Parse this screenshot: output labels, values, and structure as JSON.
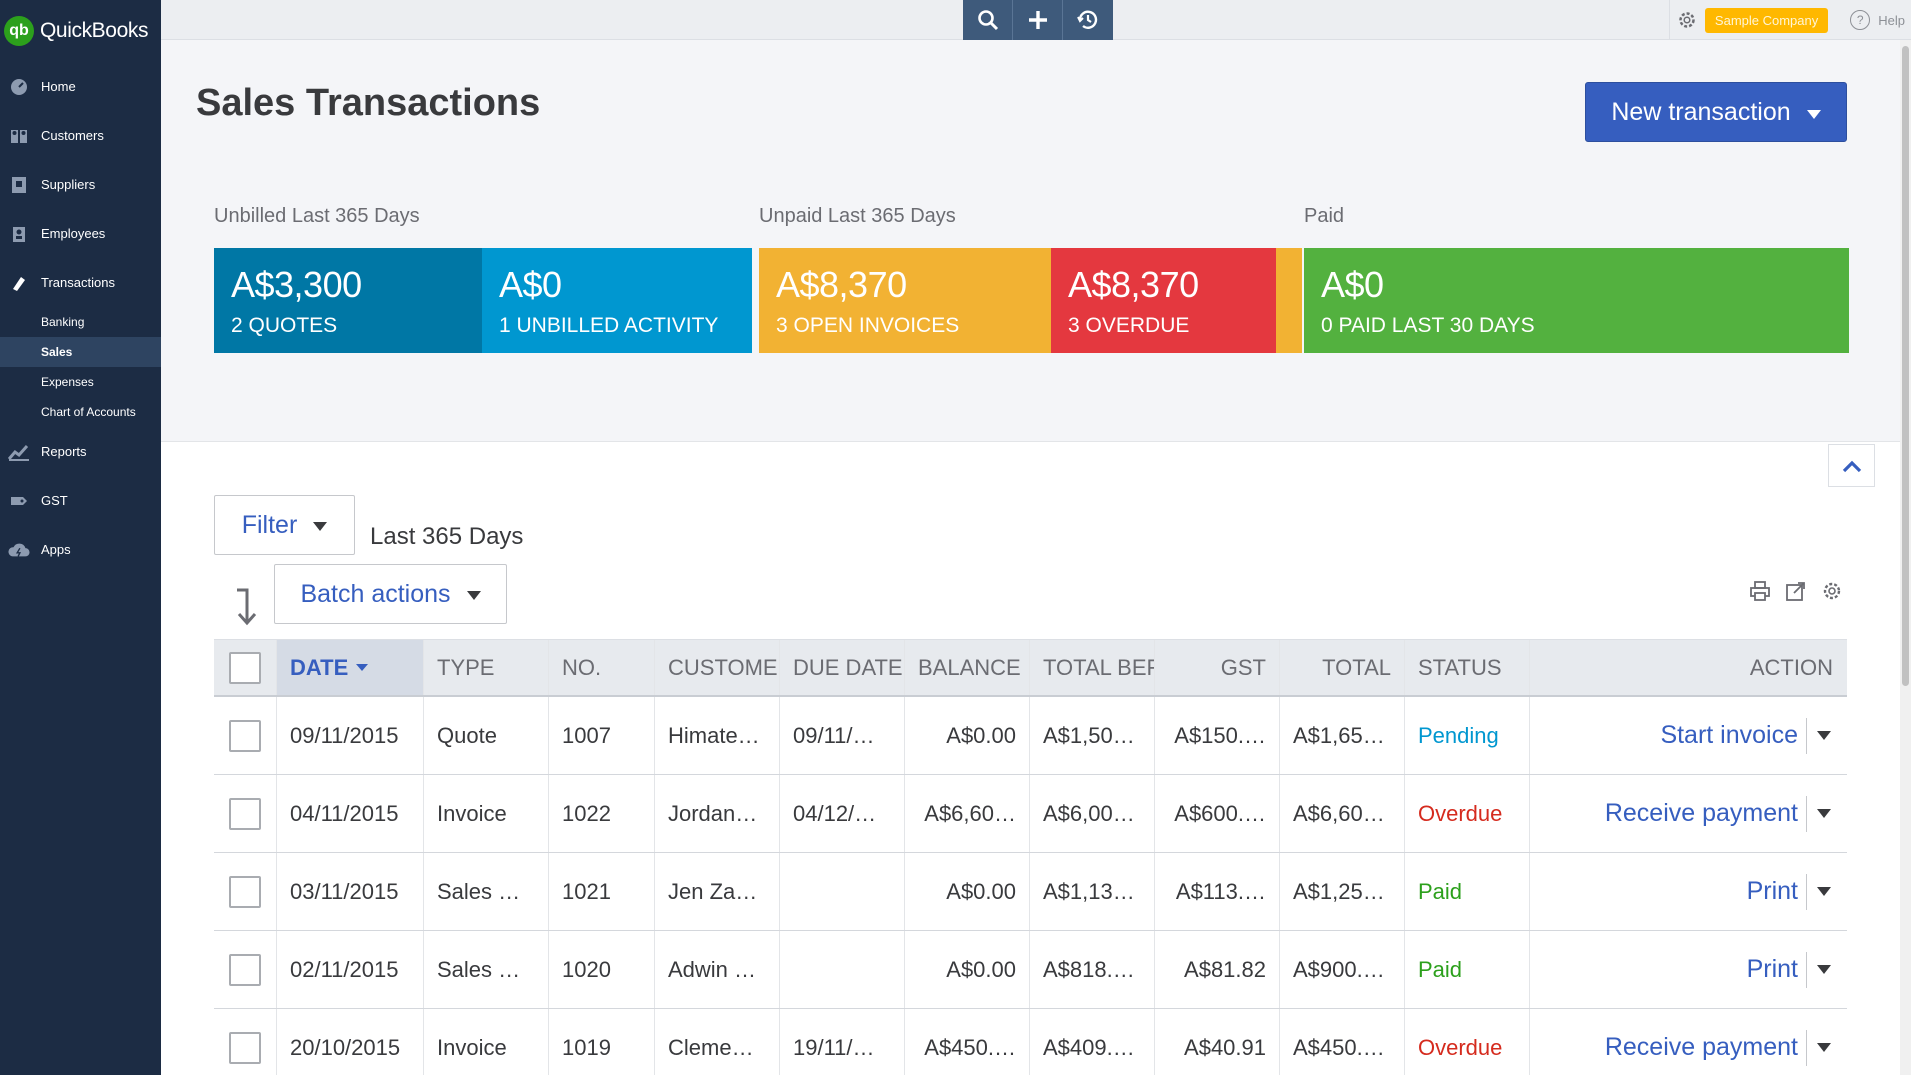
{
  "app": {
    "logo_text": "QuickBooks",
    "logo_badge": "qb"
  },
  "sidebar": {
    "items": [
      {
        "label": "Home",
        "icon": "home-dial-icon"
      },
      {
        "label": "Customers",
        "icon": "customers-icon"
      },
      {
        "label": "Suppliers",
        "icon": "suppliers-icon"
      },
      {
        "label": "Employees",
        "icon": "employees-icon"
      },
      {
        "label": "Transactions",
        "icon": "transactions-icon"
      }
    ],
    "sub_items": [
      {
        "label": "Banking"
      },
      {
        "label": "Sales",
        "active": true
      },
      {
        "label": "Expenses"
      },
      {
        "label": "Chart of Accounts"
      }
    ],
    "items_after": [
      {
        "label": "Reports",
        "icon": "reports-icon"
      },
      {
        "label": "GST",
        "icon": "gst-icon"
      },
      {
        "label": "Apps",
        "icon": "apps-cloud-icon"
      }
    ]
  },
  "topbar": {
    "company": "Sample Company",
    "help": "Help"
  },
  "page": {
    "title": "Sales Transactions",
    "new_transaction": "New transaction"
  },
  "money_bar": {
    "groups": {
      "unbilled": "Unbilled Last 365 Days",
      "unpaid": "Unpaid Last 365 Days",
      "paid": "Paid"
    },
    "segments": [
      {
        "amount": "A$3,300",
        "caption": "2 QUOTES",
        "color": "#0077a5"
      },
      {
        "amount": "A$0",
        "caption": "1 UNBILLED ACTIVITY",
        "color": "#0097d0"
      },
      {
        "amount": "A$8,370",
        "caption": "3 OPEN INVOICES",
        "color": "#f2b233"
      },
      {
        "amount": "A$8,370",
        "caption": "3 OVERDUE",
        "color": "#e4383f"
      },
      {
        "amount": "A$0",
        "caption": "0 PAID LAST 30 DAYS",
        "color": "#53b13f"
      }
    ]
  },
  "filter": {
    "label": "Filter",
    "range": "Last 365 Days",
    "batch_actions": "Batch actions"
  },
  "table": {
    "headers": {
      "date": "DATE",
      "type": "TYPE",
      "no": "NO.",
      "customer": "CUSTOMER",
      "due_date": "DUE DATE",
      "balance": "BALANCE",
      "total_before": "TOTAL BEFORE",
      "gst": "GST",
      "total": "TOTAL",
      "status": "STATUS",
      "action": "ACTION"
    },
    "rows": [
      {
        "date": "09/11/2015",
        "type": "Quote",
        "no": "1007",
        "customer": "Himate…",
        "due_date": "09/11/…",
        "balance": "A$0.00",
        "total_before": "A$1,50…",
        "gst": "A$150.…",
        "total": "A$1,65…",
        "status": "Pending",
        "status_color": "#0097d0",
        "action": "Start invoice"
      },
      {
        "date": "04/11/2015",
        "type": "Invoice",
        "no": "1022",
        "customer": "Jordan…",
        "due_date": "04/12/…",
        "balance": "A$6,60…",
        "total_before": "A$6,00…",
        "gst": "A$600.…",
        "total": "A$6,60…",
        "status": "Overdue",
        "status_color": "#d52b1e",
        "action": "Receive payment"
      },
      {
        "date": "03/11/2015",
        "type": "Sales …",
        "no": "1021",
        "customer": "Jen Za…",
        "due_date": "",
        "balance": "A$0.00",
        "total_before": "A$1,13…",
        "gst": "A$113.…",
        "total": "A$1,25…",
        "status": "Paid",
        "status_color": "#2ca01c",
        "action": "Print"
      },
      {
        "date": "02/11/2015",
        "type": "Sales …",
        "no": "1020",
        "customer": "Adwin …",
        "due_date": "",
        "balance": "A$0.00",
        "total_before": "A$818.…",
        "gst": "A$81.82",
        "total": "A$900.…",
        "status": "Paid",
        "status_color": "#2ca01c",
        "action": "Print"
      },
      {
        "date": "20/10/2015",
        "type": "Invoice",
        "no": "1019",
        "customer": "Cleme…",
        "due_date": "19/11/…",
        "balance": "A$450.…",
        "total_before": "A$409.…",
        "gst": "A$40.91",
        "total": "A$450.…",
        "status": "Overdue",
        "status_color": "#d52b1e",
        "action": "Receive payment"
      }
    ]
  }
}
